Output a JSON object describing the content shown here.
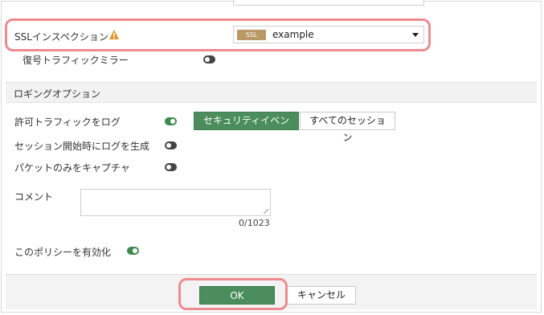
{
  "ssl_inspection": {
    "label": "SSLインスペクション",
    "badge": "SSL",
    "value": "example"
  },
  "decrypted_mirror": {
    "label": "復号トラフィックミラー",
    "enabled": false
  },
  "logging": {
    "section_title": "ロギングオプション",
    "log_allowed": {
      "label": "許可トラフィックをログ",
      "enabled": true,
      "options": [
        "セキュリティイベント",
        "すべてのセッション"
      ],
      "selected": "セキュリティイベント"
    },
    "log_on_session_start": {
      "label": "セッション開始時にログを生成",
      "enabled": false
    },
    "capture_packets": {
      "label": "パケットのみをキャプチャ",
      "enabled": false
    }
  },
  "comment": {
    "label": "コメント",
    "value": "",
    "counter": "0/1023"
  },
  "enable_policy": {
    "label": "このポリシーを有効化",
    "enabled": true
  },
  "footer": {
    "ok_label": "OK",
    "cancel_label": "キャンセル"
  },
  "colors": {
    "accent_green": "#4b8d5c",
    "highlight_pink": "#ef8a8f",
    "badge_tan": "#b99865",
    "warning_orange": "#e2962b"
  }
}
